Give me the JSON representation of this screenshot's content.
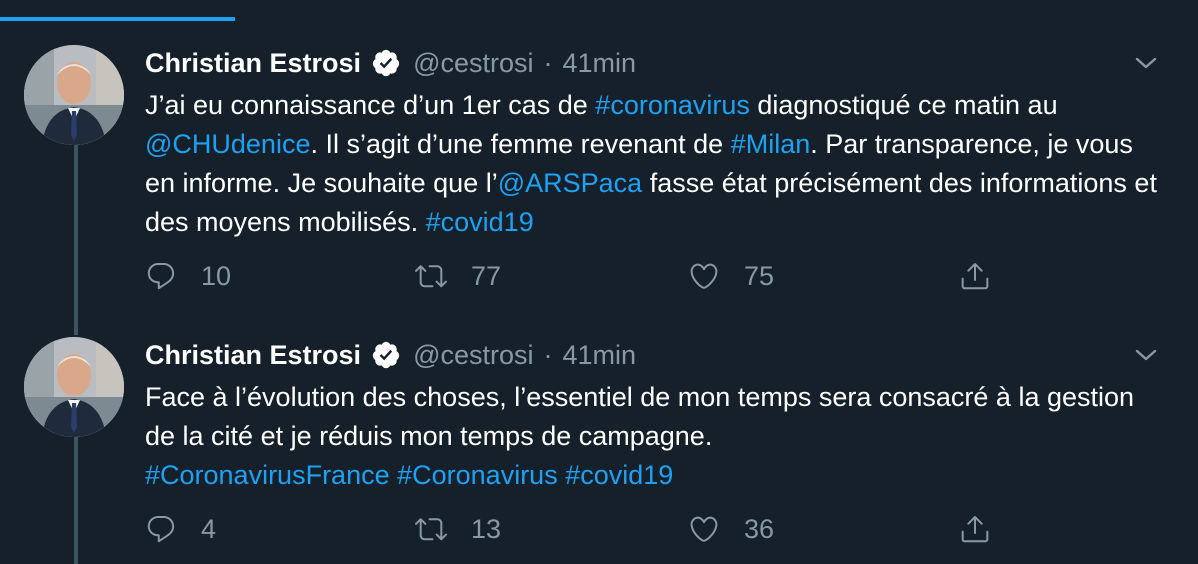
{
  "tweets": [
    {
      "author": "Christian Estrosi",
      "handle": "@cestrosi",
      "separator": "·",
      "time": "41min",
      "text_parts": [
        {
          "t": "J’ai eu connaissance d’un 1er cas de ",
          "link": false
        },
        {
          "t": "#coronavirus",
          "link": true
        },
        {
          "t": " diagnostiqué ce matin au ",
          "link": false
        },
        {
          "t": "@CHUdenice",
          "link": true
        },
        {
          "t": ". Il s’agit d’une femme revenant de ",
          "link": false
        },
        {
          "t": "#Milan",
          "link": true
        },
        {
          "t": ". Par transparence, je vous en informe. Je souhaite que l’",
          "link": false
        },
        {
          "t": "@ARSPaca",
          "link": true
        },
        {
          "t": " fasse état précisément des informations et des moyens mobilisés. ",
          "link": false
        },
        {
          "t": "#covid19",
          "link": true
        }
      ],
      "replies": "10",
      "retweets": "77",
      "likes": "75"
    },
    {
      "author": "Christian Estrosi",
      "handle": "@cestrosi",
      "separator": "·",
      "time": "41min",
      "text_parts": [
        {
          "t": "Face à l’évolution des choses, l’essentiel de mon temps sera consacré à la gestion de la cité et je réduis mon temps de campagne.",
          "link": false
        },
        {
          "t": "\n",
          "link": false
        },
        {
          "t": "#CoronavirusFrance",
          "link": true
        },
        {
          "t": " ",
          "link": false
        },
        {
          "t": "#Coronavirus",
          "link": true
        },
        {
          "t": " ",
          "link": false
        },
        {
          "t": "#covid19",
          "link": true
        }
      ],
      "replies": "4",
      "retweets": "13",
      "likes": "36"
    }
  ],
  "icons": {
    "verified": "verified-badge-icon",
    "caret": "chevron-down-icon",
    "reply": "reply-icon",
    "retweet": "retweet-icon",
    "like": "heart-icon",
    "share": "share-icon"
  },
  "colors": {
    "background": "#15202b",
    "link": "#1da1f2",
    "secondary": "#8899a6",
    "thread_line": "#3d5466"
  }
}
